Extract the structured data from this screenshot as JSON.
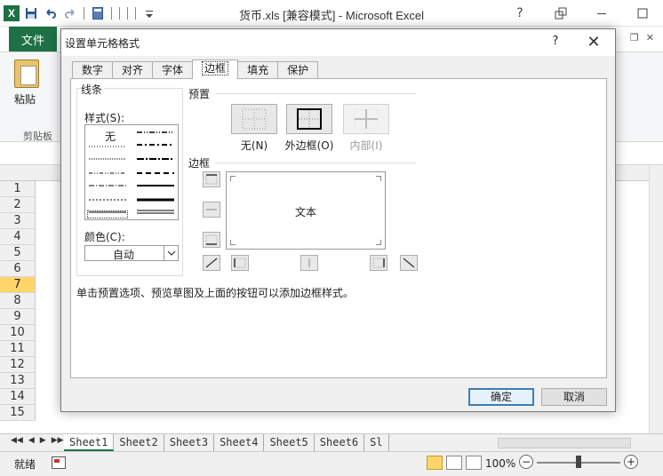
{
  "excel": {
    "window_title": "货币.xls  [兼容模式] - Microsoft Excel",
    "logo": "X",
    "file_tab": "文件",
    "ribbon": {
      "paste_label": "粘贴",
      "clipboard_group": "剪贴板"
    },
    "row_numbers": [
      "1",
      "2",
      "3",
      "4",
      "5",
      "6",
      "7",
      "8",
      "9",
      "10",
      "11",
      "12",
      "13",
      "14",
      "15"
    ],
    "active_row": "7",
    "sheet_tabs": [
      "Sheet1",
      "Sheet2",
      "Sheet3",
      "Sheet4",
      "Sheet5",
      "Sheet6",
      "Sl"
    ],
    "active_sheet": "Sheet1",
    "status": {
      "ready": "就绪",
      "zoom": "100%",
      "zoom_minus": "−",
      "zoom_plus": "+"
    }
  },
  "dialog": {
    "title": "设置单元格格式",
    "help": "?",
    "close": "✕",
    "tabs": [
      "数字",
      "对齐",
      "字体",
      "边框",
      "填充",
      "保护"
    ],
    "active_tab": "边框",
    "line_group": {
      "title": "线条",
      "style_label": "样式(S):",
      "style_none": "无",
      "color_label": "颜色(C):",
      "color_value": "自动"
    },
    "presets": {
      "title": "预置",
      "none_label": "无(N)",
      "outline_label": "外边框(O)",
      "inside_label": "内部(I)"
    },
    "border": {
      "title": "边框",
      "preview_text": "文本"
    },
    "hint": "单击预置选项、预览草图及上面的按钮可以添加边框样式。",
    "ok_label": "确定",
    "cancel_label": "取消"
  }
}
